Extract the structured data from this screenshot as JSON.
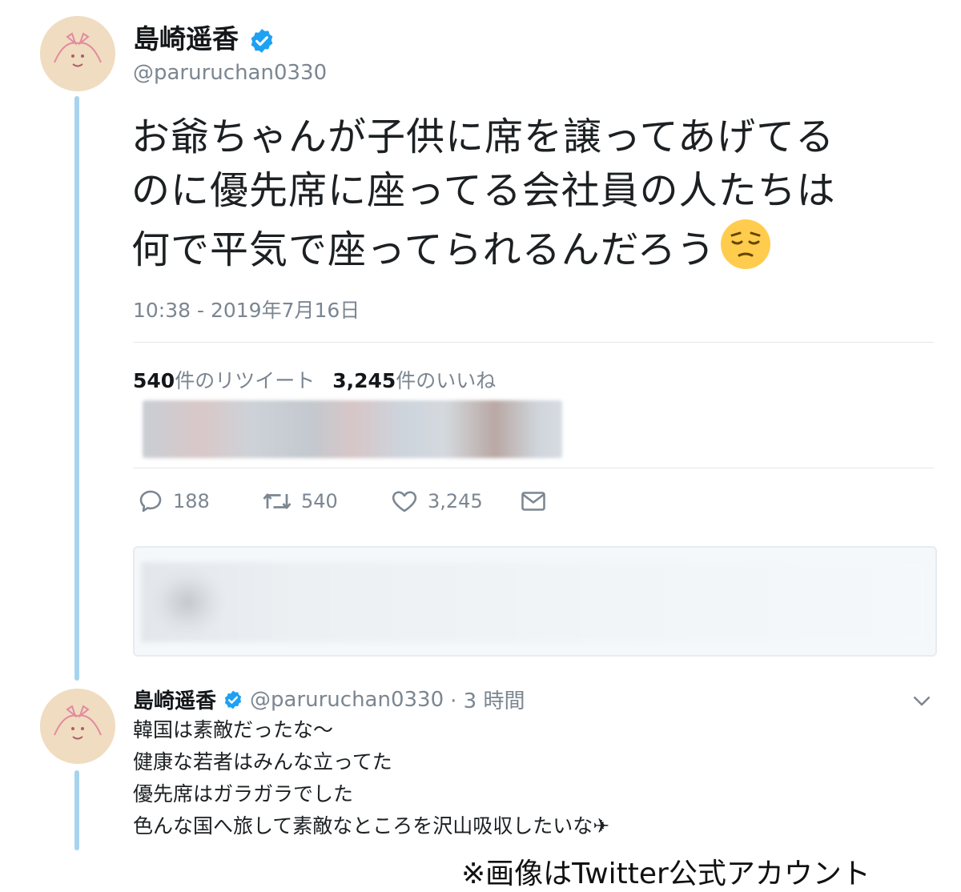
{
  "tweet": {
    "display_name": "島崎遥香",
    "handle": "@paruruchan0330",
    "lines": [
      "お爺ちゃんが子供に席を譲ってあげてる",
      "のに優先席に座ってる会社員の人たちは",
      "何で平気で座ってられるんだろう"
    ],
    "emoji": "pensive-face-icon",
    "timestamp": "10:38 - 2019年7月16日",
    "retweet_count": "540",
    "retweet_label": "件のリツイート",
    "like_count": "3,245",
    "like_label": "件のいいね",
    "actions": {
      "reply": "188",
      "retweet": "540",
      "like": "3,245"
    }
  },
  "reply_tweet": {
    "display_name": "島崎遥香",
    "handle": "@paruruchan0330",
    "time": "· 3 時間",
    "lines": [
      "韓国は素敵だったな～",
      "健康な若者はみんな立ってた",
      "優先席はガラガラでした",
      "色んな国へ旅して素敵なところを沢山吸収したいな✈"
    ]
  },
  "credit": "※画像はTwitter公式アカウント",
  "colors": {
    "verified": "#1da1f2",
    "thread_line": "#a7d3ef",
    "muted_text": "#7b8691"
  }
}
